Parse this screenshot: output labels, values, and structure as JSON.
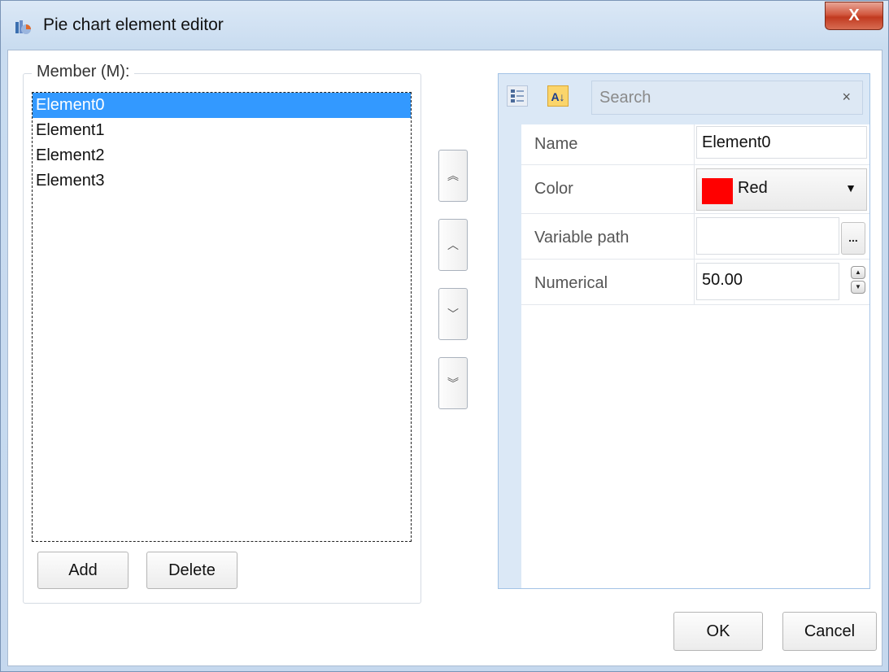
{
  "window": {
    "title": "Pie chart element editor",
    "close_glyph": "X",
    "icon": "pie-chart-app-icon"
  },
  "member_group": {
    "legend": "Member (M):",
    "items": [
      "Element0",
      "Element1",
      "Element2",
      "Element3"
    ],
    "selected_index": 0,
    "add_label": "Add",
    "delete_label": "Delete"
  },
  "move_buttons": {
    "top_glyph": "︽",
    "up_glyph": "︿",
    "down_glyph": "﹀",
    "bottom_glyph": "︾"
  },
  "property_grid": {
    "categorized_icon": "categorized-view-icon",
    "alphabetical_icon": "alphabetical-sort-icon",
    "alphabetical_glyph": "A↓",
    "search_placeholder": "Search",
    "search_clear_glyph": "×",
    "properties": {
      "name": {
        "label": "Name",
        "value": "Element0"
      },
      "color": {
        "label": "Color",
        "value": "Red",
        "swatch": "#ff0000",
        "arrow": "▼"
      },
      "variable_path": {
        "label": "Variable path",
        "value": "",
        "browse": "..."
      },
      "numerical": {
        "label": "Numerical",
        "value": "50.00"
      }
    }
  },
  "footer": {
    "ok_label": "OK",
    "cancel_label": "Cancel"
  },
  "colors": {
    "selection": "#3399ff",
    "title_bar": "#c9dcf0",
    "close_button": "#c13a20"
  }
}
